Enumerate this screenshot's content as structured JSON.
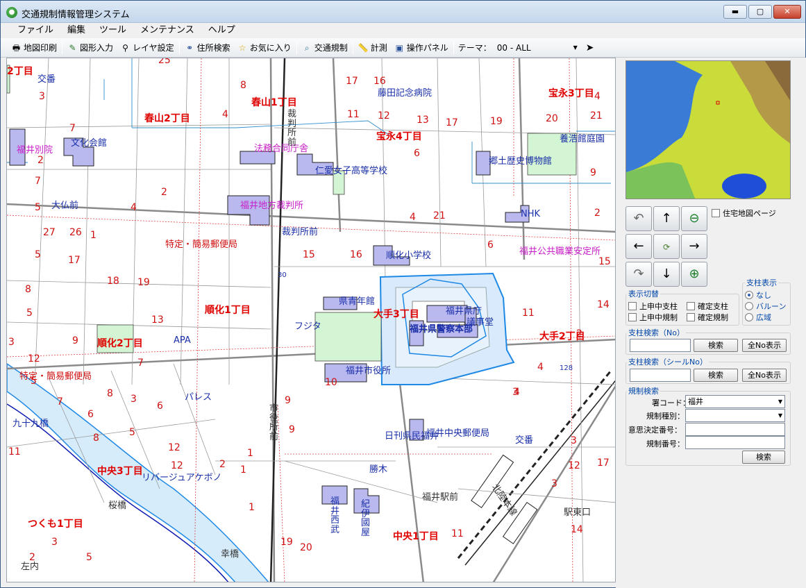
{
  "window": {
    "title": "交通規制情報管理システム",
    "icon": "globe-leaf-icon",
    "controls": {
      "minimize": "▬",
      "maximize": "▢",
      "close": "✕"
    }
  },
  "menu": [
    "ファイル",
    "編集",
    "ツール",
    "メンテナンス",
    "ヘルプ"
  ],
  "toolbar": {
    "print": "地図印刷",
    "shape": "図形入力",
    "layer": "レイヤ設定",
    "address": "住所検索",
    "favorite": "お気に入り",
    "traffic": "交通規制",
    "measure": "計測",
    "panel": "操作パネル",
    "theme_label": "テーマ：",
    "theme_value": "00 - ALL"
  },
  "map": {
    "areas": [
      "春山1丁目",
      "春山2丁目",
      "宝永3丁目",
      "宝永4丁目",
      "順化1丁目",
      "順化2丁目",
      "大手2丁目",
      "大手3丁目",
      "中央3丁目",
      "中央1丁目",
      "つくも1丁目",
      "2丁目"
    ],
    "places_blue": [
      "交番",
      "藤田記念病院",
      "文化会館",
      "養浩館庭園",
      "仁愛女子高等学校",
      "郷土歴史博物館",
      "大仏前",
      "NHK",
      "裁判所前",
      "順化小学校",
      "県青年館",
      "福井県庁",
      "議事堂",
      "フジタ",
      "APA",
      "福井市役所",
      "パレス",
      "日刊県民福井",
      "福井中央郵便局",
      "九十九橋",
      "交番",
      "リバージュアケボノ",
      "勝木",
      "桜橋",
      "福井駅前",
      "福井西武",
      "紀伊國屋",
      "駅東口",
      "幸橋",
      "左内",
      "福井県警察本部",
      "裁判所前"
    ],
    "places_magenta": [
      "福井別院",
      "法務合同庁舎",
      "福井地方裁判所",
      "福井公共職業安定所"
    ],
    "places_red_label": [
      "特定・簡易郵便局",
      "特定・簡易郵便局"
    ],
    "vertical_labels": [
      "裁判所前",
      "市役所前",
      "北陸本線"
    ],
    "block_numbers": [
      "25",
      "8",
      "17",
      "16",
      "4",
      "11",
      "12",
      "13",
      "17",
      "19",
      "20",
      "21",
      "3",
      "7",
      "2",
      "6",
      "4",
      "2",
      "7",
      "4",
      "5",
      "9",
      "2",
      "27",
      "26",
      "1",
      "4",
      "21",
      "6",
      "5",
      "17",
      "15",
      "16",
      "30",
      "18",
      "19",
      "15",
      "5",
      "13",
      "8",
      "11",
      "14",
      "3",
      "9",
      "12",
      "9",
      "7",
      "4",
      "3",
      "5",
      "10",
      "7",
      "8",
      "6",
      "3",
      "5",
      "12",
      "4",
      "128",
      "4",
      "2",
      "5",
      "6",
      "7",
      "1",
      "3",
      "9",
      "17",
      "12",
      "3",
      "2",
      "1",
      "3",
      "12",
      "3",
      "1",
      "2",
      "19",
      "20",
      "11",
      "14",
      "5",
      "11",
      "10",
      "5",
      "8",
      "6",
      "2"
    ]
  },
  "panel": {
    "residential_check": "住宅地図ページ",
    "nav": {
      "rotate_ccw": "rotate-ccw-icon",
      "up": "arrow-up-icon",
      "zoom_out": "zoom-out-icon",
      "left": "arrow-left-icon",
      "center": "refresh-icon",
      "right": "arrow-right-icon",
      "rotate_cw": "rotate-cw-icon",
      "down": "arrow-down-icon",
      "zoom_in": "zoom-in-icon"
    },
    "display_toggle": {
      "legend": "表示切替",
      "options": [
        "上申中支柱",
        "確定支柱",
        "上申中規制",
        "確定規制"
      ]
    },
    "pole_display": {
      "legend": "支柱表示",
      "options": [
        "なし",
        "バルーン",
        "広域"
      ],
      "selected": "なし"
    },
    "pole_search_no": {
      "legend": "支柱検索（No）",
      "search": "検索",
      "show_all": "全No表示"
    },
    "pole_search_seal": {
      "legend": "支柱検索（シールNo）",
      "search": "検索",
      "show_all": "全No表示"
    },
    "reg_search": {
      "legend": "規制検索",
      "station_label": "署コード：",
      "station_value": "福井",
      "type_label": "規制種別：",
      "type_value": "",
      "decision_label": "意思決定番号：",
      "reg_no_label": "規制番号：",
      "search": "検索"
    }
  }
}
